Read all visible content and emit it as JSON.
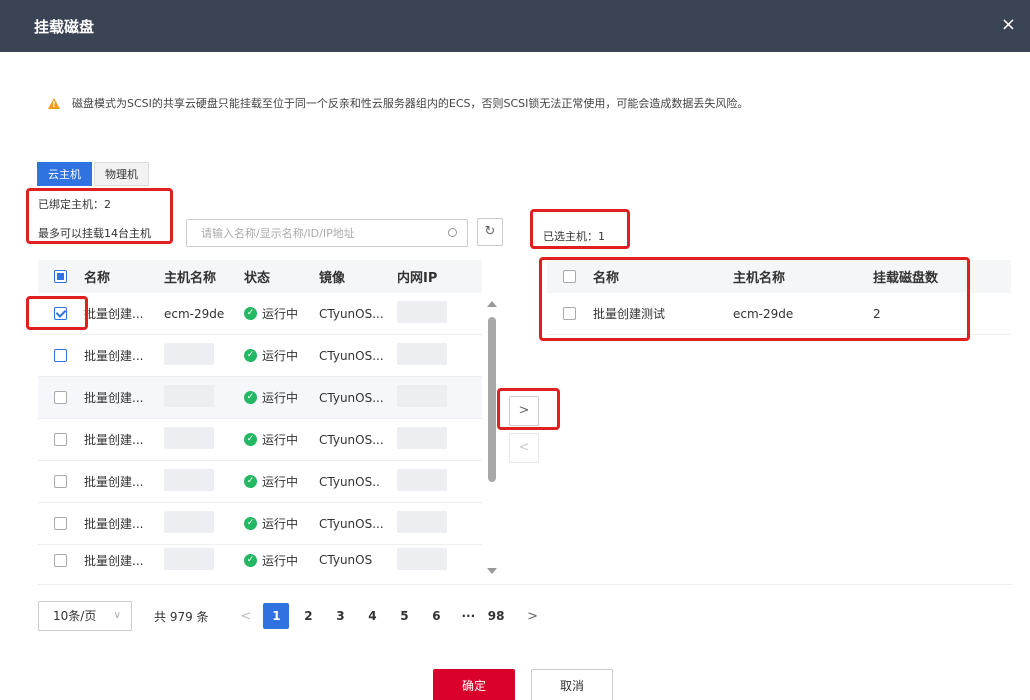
{
  "dialog": {
    "title": "挂载磁盘",
    "close_icon": "×"
  },
  "warning": {
    "text": "磁盘模式为SCSI的共享云硬盘只能挂载至位于同一个反亲和性云服务器组内的ECS，否则SCSI锁无法正常使用，可能会造成数据丢失风险。",
    "icon": "warning-icon",
    "color": "#f39c12"
  },
  "tabs": [
    {
      "label": "云主机",
      "active": true
    },
    {
      "label": "物理机",
      "active": false
    }
  ],
  "bound_hosts": "已绑定主机：2",
  "max_hosts": "最多可以挂载14台主机",
  "selected_hosts": "已选主机：1",
  "search": {
    "placeholder": "请输入名称/显示名称/ID/IP地址",
    "value": ""
  },
  "left_table": {
    "headers": [
      "名称",
      "主机名称",
      "状态",
      "镜像",
      "内网IP"
    ],
    "rows": [
      {
        "name": "批量创建...",
        "host": "ecm-29de",
        "status": "运行中",
        "image": "CTyunOS...",
        "checked": true
      },
      {
        "name": "批量创建...",
        "host": "",
        "status": "运行中",
        "image": "CTyunOS...",
        "checked": false
      },
      {
        "name": "批量创建...",
        "host": "",
        "status": "运行中",
        "image": "CTyunOS...",
        "checked": false
      },
      {
        "name": "批量创建...",
        "host": "",
        "status": "运行中",
        "image": "CTyunOS...",
        "checked": false
      },
      {
        "name": "批量创建...",
        "host": "",
        "status": "运行中",
        "image": "CTyunOS..",
        "checked": false
      },
      {
        "name": "批量创建...",
        "host": "",
        "status": "运行中",
        "image": "CTyunOS...",
        "checked": false
      },
      {
        "name": "批量创建...",
        "host": "",
        "status": "运行中",
        "image": "CTyunOS",
        "checked": false
      }
    ]
  },
  "transfer": {
    "right_label": ">",
    "left_label": "<"
  },
  "right_table": {
    "headers": [
      "名称",
      "主机名称",
      "挂载磁盘数"
    ],
    "rows": [
      {
        "name": "批量创建测试",
        "host": "ecm-29de",
        "count": "2"
      }
    ]
  },
  "pagination": {
    "page_size": "10条/页",
    "total": "共 979 条",
    "pages": [
      "1",
      "2",
      "3",
      "4",
      "5",
      "6"
    ],
    "ellipsis": "···",
    "last": "98",
    "prev": "<",
    "next": ">",
    "current": "1"
  },
  "buttons": {
    "ok": "确定",
    "cancel": "取消"
  },
  "colors": {
    "header_bg": "#3a4455",
    "primary": "#2f72e0",
    "ok": "#d9002b",
    "status_green": "#25b864",
    "highlight_box": "#e02020"
  }
}
